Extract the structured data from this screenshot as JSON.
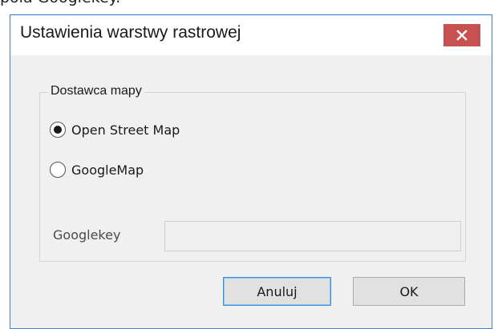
{
  "background_text": "pola Googlekey.",
  "dialog": {
    "title": "Ustawienia warstwy rastrowej",
    "close_icon": "close-icon",
    "accent_color": "#c75050"
  },
  "group": {
    "legend": "Dostawca mapy",
    "options": [
      {
        "label": "Open Street Map",
        "selected": true
      },
      {
        "label": "GoogleMap",
        "selected": false
      }
    ],
    "googlekey_label": "Googlekey",
    "googlekey_value": ""
  },
  "buttons": {
    "cancel_label": "Anuluj",
    "ok_label": "OK"
  }
}
